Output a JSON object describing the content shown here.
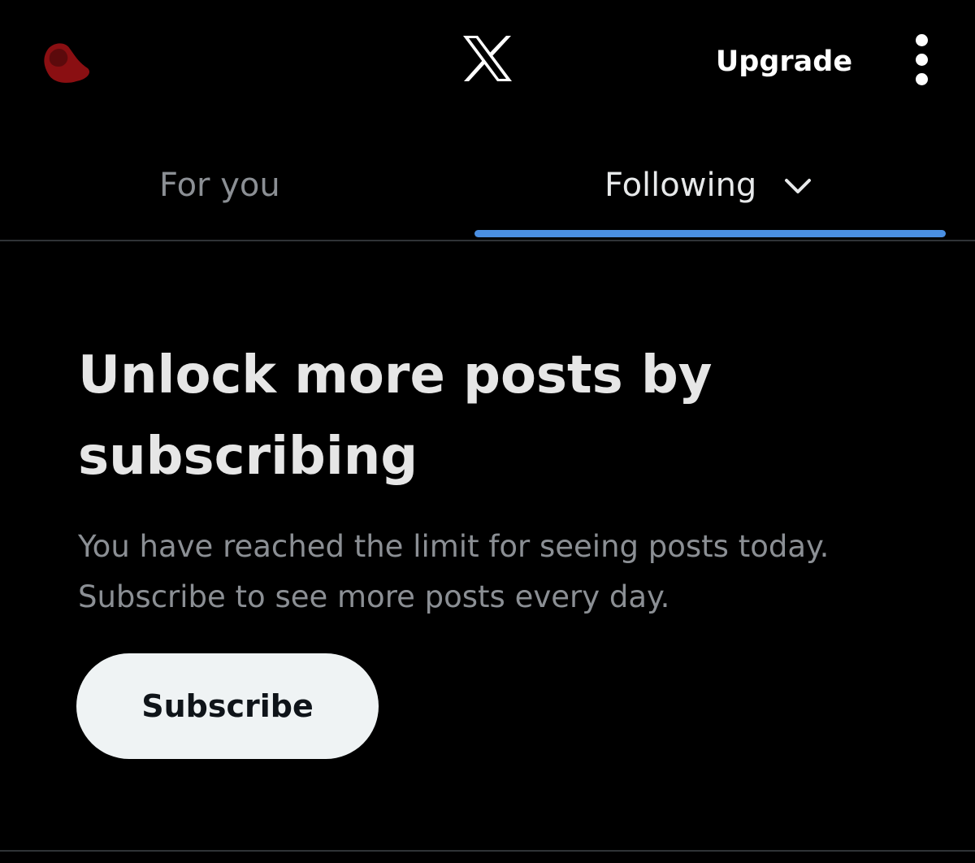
{
  "header": {
    "logo_icon": "x-logo-icon",
    "avatar_icon": "avatar-icon",
    "upgrade_label": "Upgrade",
    "more_icon": "more-vertical-icon"
  },
  "tabs": [
    {
      "label": "For you",
      "selected": false
    },
    {
      "label": "Following",
      "selected": true,
      "icon": "chevron-down-icon"
    }
  ],
  "paywall": {
    "headline": "Unlock more posts by subscribing",
    "body": "You have reached the limit for seeing posts today. Subscribe to see more posts every day.",
    "subscribe_label": "Subscribe"
  },
  "colors": {
    "background": "#000000",
    "accent": "#4a8fe2",
    "text_primary": "#e7e9ea",
    "text_secondary": "#8b8f94",
    "button_bg": "#eff3f4",
    "divider": "#2f3336",
    "avatar": "#8a0f12"
  }
}
